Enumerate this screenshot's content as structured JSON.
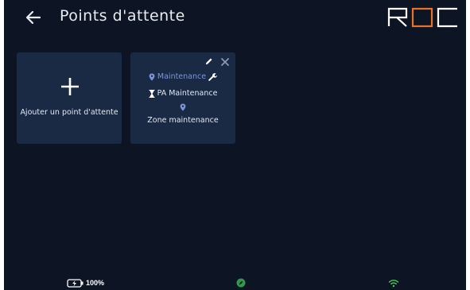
{
  "header": {
    "title": "Points d'attente",
    "back_icon": "arrow-left-icon",
    "logo_text": "ROC",
    "logo_colors": {
      "primary": "#ffffff",
      "accent": "#e8722a"
    }
  },
  "cards": {
    "add": {
      "icon": "plus-icon",
      "label": "Ajouter un point d'attente"
    },
    "point": {
      "category": "Maintenance",
      "name": "PA Maintenance",
      "zone": "Zone maintenance",
      "icons": [
        "pencil-icon",
        "close-icon",
        "map-pin-icon",
        "wrench-icon",
        "hourglass-icon"
      ]
    }
  },
  "status_bar": {
    "battery_text": "100%",
    "battery_icon": "battery-charging-icon",
    "compass_icon": "compass-icon",
    "wifi_icon": "wifi-icon"
  },
  "colors": {
    "background": "#0d1525",
    "card": "#1a2a45",
    "category_text": "#7d95d6",
    "accent": "#e8722a",
    "wifi": "#3ccf5a",
    "compass": "#2e9a4a"
  }
}
